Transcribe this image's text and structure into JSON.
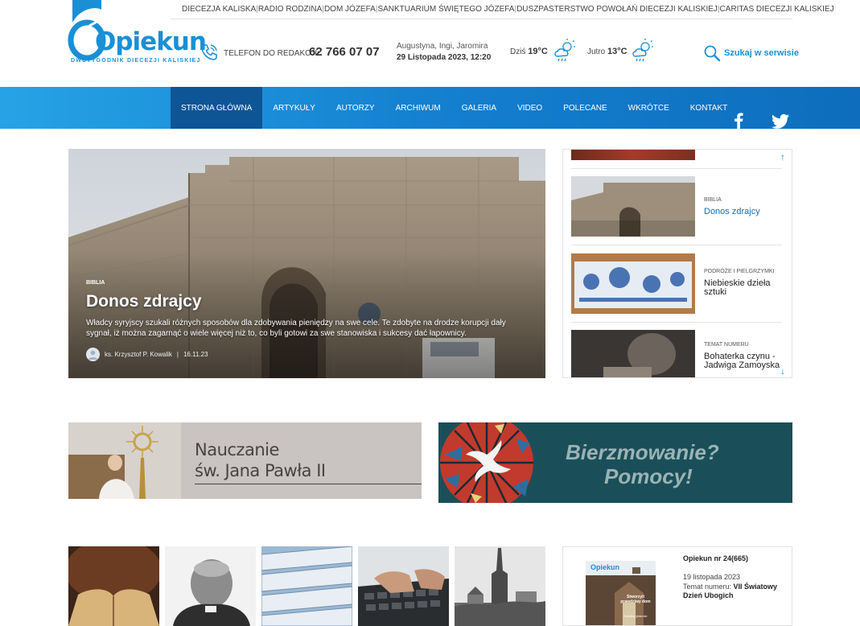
{
  "brand": {
    "name": "Opiekun",
    "tagline": "DWUTYGODNIK DIECEZJI KALISKIEJ",
    "color": "#1a8fd6"
  },
  "toplinks": [
    "DIECEZJA KALISKA",
    "RADIO RODZINA",
    "DOM JÓZEFA",
    "SANKTUARIUM ŚWIĘTEGO JÓZEFA",
    "DUSZPASTERSTWO POWOŁAŃ DIECEZJI KALISKIEJ",
    "CARITAS DIECEZJI KALISKIEJ"
  ],
  "contact": {
    "label": "TELEFON DO REDAKCJI:",
    "phone": "62 766 07 07",
    "icon": "phone-icon"
  },
  "calendar": {
    "names": "Augustyna, Ingi, Jaromira",
    "datetime": "29 Listopada 2023, 12:20"
  },
  "weather": {
    "today_label": "Dziś",
    "today_temp": "19°C",
    "tomorrow_label": "Jutro",
    "tomorrow_temp": "13°C",
    "icon": "cloud-rain-sun-icon"
  },
  "search": {
    "label": "Szukaj w serwisie",
    "icon": "search-icon"
  },
  "nav": {
    "items": [
      "STRONA GŁÓWNA",
      "ARTYKUŁY",
      "AUTORZY",
      "ARCHIWUM",
      "GALERIA",
      "VIDEO",
      "POLECANE",
      "WKRÓTCE",
      "KONTAKT"
    ],
    "active_index": 0,
    "social": [
      "facebook-icon",
      "twitter-icon"
    ]
  },
  "hero": {
    "category": "BIBLIA",
    "title": "Donos zdrajcy",
    "lead": "Władcy syryjscy szukali różnych sposobów dla zdobywania pieniędzy na swe cele. Te zdobyte na drodze korupcji dały sygnał, iż można zagarnąć o wiele więcej niż to, co byli gotowi za swe stanowiska i sukcesy dać łapownicy.",
    "author": "ks. Krzysztof P. Kowalik",
    "date": "16.11.23"
  },
  "side_list": [
    {
      "category": "BIBLIA",
      "title": "Donos zdrajcy"
    },
    {
      "category": "PODRÓŻE I PIELGRZYMKI",
      "title": "Niebieskie dzieła sztuki"
    },
    {
      "category": "TEMAT NUMERU",
      "title": "Bohaterka czynu - Jadwiga Zamoyska"
    }
  ],
  "banners": {
    "jp2_line1": "Nauczanie",
    "jp2_line2": "św. Jana Pawła II",
    "bierz_line1": "Bierzmowanie?",
    "bierz_line2": "Pomocy!"
  },
  "magazine": {
    "title": "Opiekun nr 24(665)",
    "date": "19 listopada 2023",
    "topic_label": "Temat numeru:",
    "topic": "VII Światowy Dzień Ubogich",
    "cover_brand": "Opiekun",
    "cover_headline": "Stworzyli prawdziwy dom",
    "cover_sub": "Katolicy jedność"
  }
}
